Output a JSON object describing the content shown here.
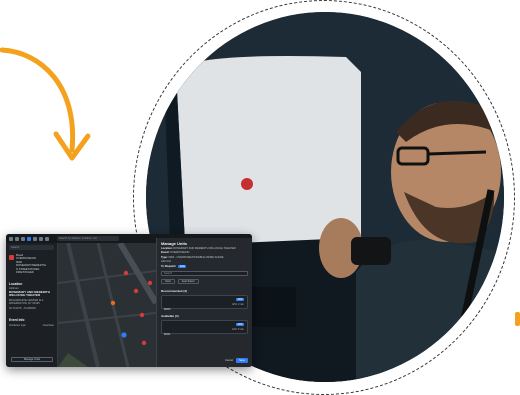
{
  "app": {
    "search_placeholder": "Search by address, incident, unit",
    "left_panel": {
      "search_placeholder": "Search",
      "incident_lines": [
        "Board",
        "OVERDOSE/OD",
        "0000",
        "ROSEMARY/MEREDITH",
        "N STREET/ZONES",
        "FIRE/STAGED"
      ],
      "location_heading": "Location",
      "address_label": "Address",
      "address_value": "ROSEMARY AND MEREDITH WILLOUGH THEATER",
      "address_detail": "BCC/ARCHIVE CENTER FL2\nWASHINGTON, NY 00135",
      "coords": "40.712375, -74.006062",
      "event_heading": "Event Info",
      "event_row": [
        "Incidence type",
        "Overdose"
      ],
      "manage_button": "Manage Units"
    },
    "map": {
      "unit_label": "0001",
      "street_label": "Rosemary St"
    },
    "modal": {
      "title": "Manage Units",
      "location_label": "Location:",
      "location_value": "ROSEMARY AND MEREDITH WILLOUGH THEATER",
      "board_label": "Board:",
      "board_value": "OVERDOSE/OD",
      "type_label": "Type:",
      "type_value": "0000 - OVERDOSE/POSSIBLE CRIME SCENE",
      "unit_add_label": "Add Unit",
      "assign_label": "To Dispatch",
      "assign_badge": "ADD",
      "input_placeholder": "Search",
      "chip_one": "Units",
      "chip_two": "Auto Select",
      "recommended_heading": "Recommended (3)",
      "recommended_unit": "M003",
      "recommended_badge": "ADD",
      "recommended_eta": "ETA: 2 min",
      "available_heading": "Available (4)",
      "available_unit": "M001",
      "available_badge": "ADD",
      "available_eta": "ETA: 5 min",
      "cancel": "Cancel",
      "save": "Save"
    }
  },
  "colors": {
    "accent": "#f4a21d",
    "primary": "#2f7cf6",
    "alert": "#d93a3a"
  }
}
